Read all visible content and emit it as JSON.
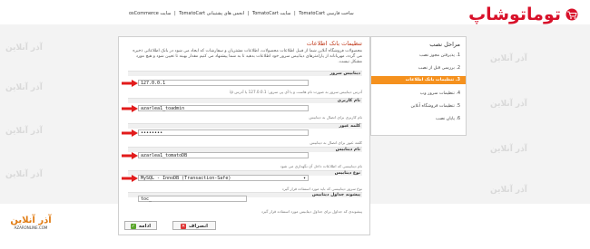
{
  "header": {
    "links": [
      "ساخت فارسی TomatoCart",
      "سایت TomatoCart",
      "انجمن های پشتیبانی TomatoCart",
      "سایت osCommerce"
    ],
    "logo_text": "توماتوشاپ"
  },
  "watermark": {
    "text": "آذر آنلاین"
  },
  "panel": {
    "title": "تنظیمات بانک اطلاعات",
    "description": "محصولات فروشگاه آنلاین شما از قبیل اطلاعات محصولات، اطلاعات مشتریان و سفارشات که ایجاد می شود در بانک اطلاعاتی ذخیره می گردد، مهربانانه از پارامترهای دیتابیس سرور خود اطلاعات بدهید تا به شما پیشنهاد می کنیم مقدار بهینه تا تعیین شود و هیچ مورد مشکل نیست.",
    "fields": [
      {
        "label": "دیتابیس سرور",
        "value": "127.0.0.1",
        "hint": "آدرس دیتابیس سرور به صورت نام هاست و یا آی پی سرور: 127.0.0.1 یا آدرس ip"
      },
      {
        "label": "نام کاربری",
        "value": "azarlea1_toadmin",
        "hint": "نام کاربری برای اتصال به دیتابیس"
      },
      {
        "label": "کلمه عبور",
        "value": "••••••••",
        "hint": "کلمه عبور برای اتصال به دیتابیس"
      },
      {
        "label": "نام دیتابیس",
        "value": "azarlea1_tomatoDB",
        "hint": "نام دیتابیسی که اطلاعات داخل آن نگهداری می شود"
      },
      {
        "label": "نوع دیتابیس",
        "value": "MySQL - InnoDB (Transaction-Safe)",
        "hint": "نوع سرور دیتابیسی که باید مورد استفاده قرار گیرد"
      },
      {
        "label": "پیشوند جداول دیتابیس",
        "value": "toc_",
        "hint": "پیشوندی که جداول برای جداول دیتابیس مورد استفاده قرار گیرد"
      }
    ],
    "back_button": "انصراف",
    "continue_button": "ادامه"
  },
  "sidebar": {
    "title": "مراحل نصب",
    "items": [
      "1. پذیرفتن مجوز نصب",
      "2. بررسی قبل از نصب",
      "3. تنظیمات بانک اطلاعات",
      "4. تنظیمات سرور وب",
      "5. تنظیمات فروشگاه آنلاین",
      "6. پایان نصب"
    ],
    "active_index": 2
  },
  "footer_logo": {
    "text": "آذر آنلاین",
    "sub": "AZARONLINE.COM"
  },
  "colors": {
    "accent": "#f5911e",
    "brand_red": "#d8112a",
    "arrow_red": "#e21b1b",
    "title_red": "#c0391b"
  }
}
